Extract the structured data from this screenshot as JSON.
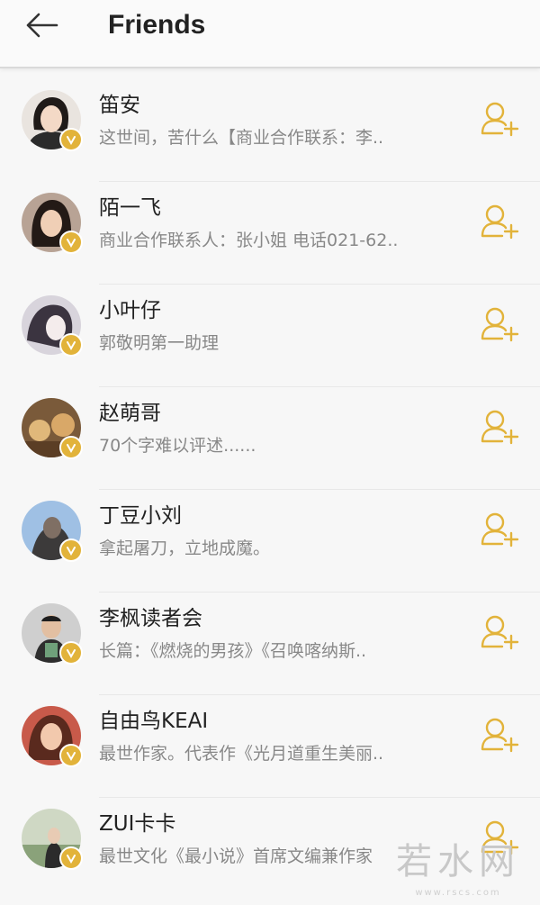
{
  "header": {
    "title": "Friends",
    "back_icon": "arrow-left-icon"
  },
  "colors": {
    "accent": "#e2b33a",
    "name": "#222222",
    "desc": "#888888",
    "divider": "#e8e8e8"
  },
  "icons": {
    "verified_badge": "verified-v-icon",
    "add_friend": "add-person-icon"
  },
  "friends": [
    {
      "name": "笛安",
      "desc": "这世间，苦什么【商业合作联系：李.."
    },
    {
      "name": "陌一飞",
      "desc": "商业合作联系人：张小姐 电话021-62.."
    },
    {
      "name": "小叶仔",
      "desc": "郭敬明第一助理"
    },
    {
      "name": "赵萌哥",
      "desc": "70个字难以评述......"
    },
    {
      "name": "丁豆小刘",
      "desc": "拿起屠刀，立地成魔。"
    },
    {
      "name": "李枫读者会",
      "desc": "长篇：《燃烧的男孩》《召唤喀纳斯.."
    },
    {
      "name": "自由鸟KEAI",
      "desc": "最世作家。代表作《光月道重生美丽.."
    },
    {
      "name": "ZUI卡卡",
      "desc": "最世文化《最小说》首席文编兼作家"
    }
  ],
  "watermark": {
    "text": "若水网",
    "url": "www.rscs.com"
  }
}
